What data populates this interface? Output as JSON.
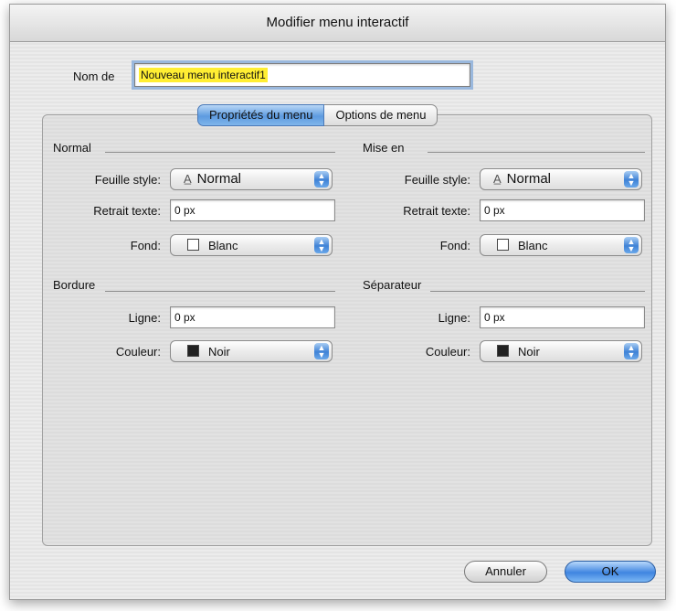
{
  "window": {
    "title": "Modifier menu interactif"
  },
  "name_field": {
    "label": "Nom de",
    "value": "Nouveau menu interactif1"
  },
  "tabs": [
    {
      "label": "Propriétés du menu",
      "active": true
    },
    {
      "label": "Options de menu",
      "active": false
    }
  ],
  "normal": {
    "title": "Normal",
    "style_label": "Feuille style:",
    "style_value": "Normal",
    "indent_label": "Retrait texte:",
    "indent_value": "0 px",
    "bg_label": "Fond:",
    "bg_value": "Blanc"
  },
  "highlight": {
    "title": "Mise en",
    "style_label": "Feuille style:",
    "style_value": "Normal",
    "indent_label": "Retrait texte:",
    "indent_value": "0 px",
    "bg_label": "Fond:",
    "bg_value": "Blanc"
  },
  "border": {
    "title": "Bordure",
    "line_label": "Ligne:",
    "line_value": "0 px",
    "color_label": "Couleur:",
    "color_value": "Noir"
  },
  "separator": {
    "title": "Séparateur",
    "line_label": "Ligne:",
    "line_value": "0 px",
    "color_label": "Couleur:",
    "color_value": "Noir"
  },
  "buttons": {
    "cancel": "Annuler",
    "ok": "OK"
  },
  "colors": {
    "accent": "#3f85e0",
    "selection": "#ffee33",
    "white": "#ffffff",
    "black": "#222222"
  },
  "icons": {
    "style_glyph": "stylesheet-icon",
    "popup_arrows": "up-down-arrows-icon"
  }
}
